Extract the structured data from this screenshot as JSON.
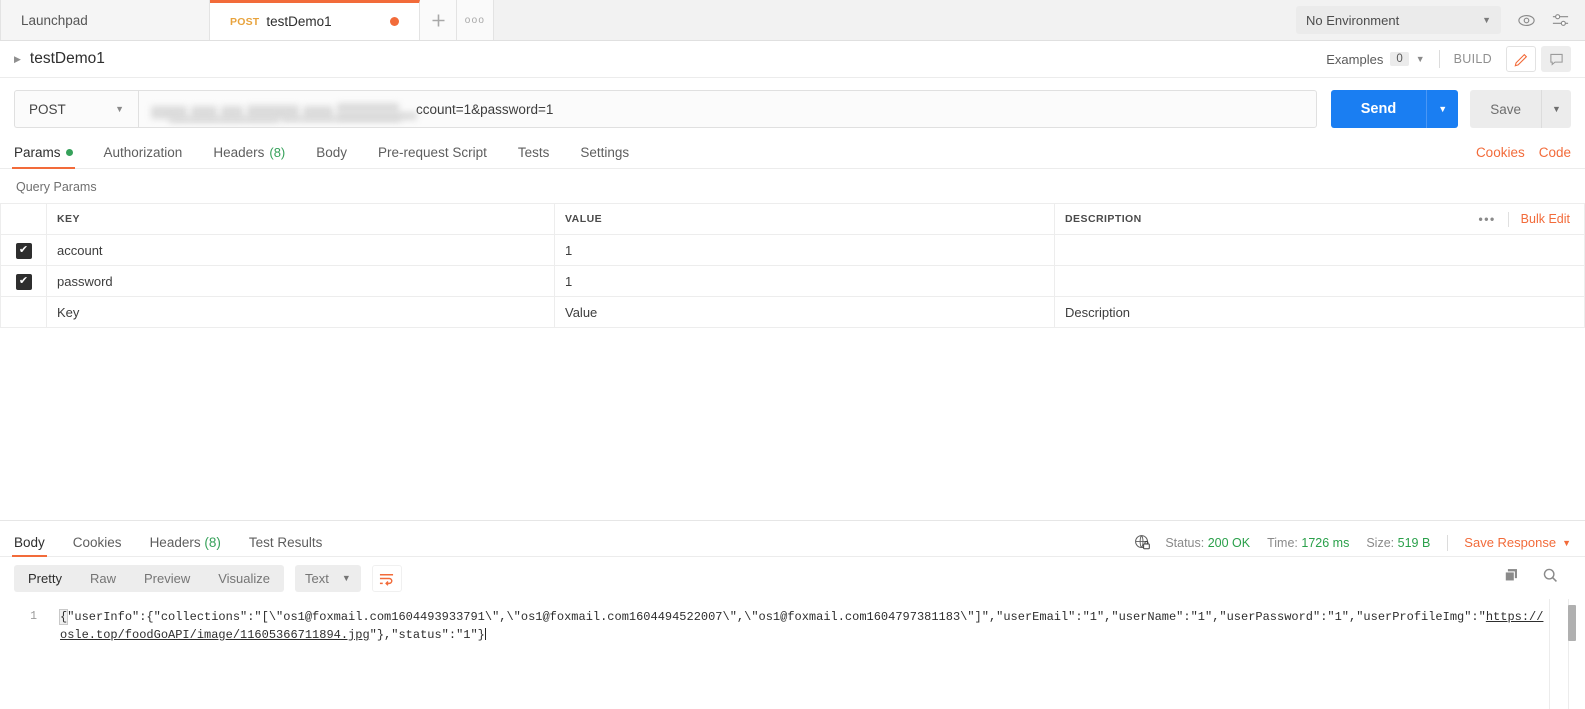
{
  "tabbar": {
    "tabs": [
      {
        "label": "Launchpad",
        "method": "",
        "dirty": false,
        "active": false
      },
      {
        "label": "testDemo1",
        "method": "POST",
        "dirty": true,
        "active": true
      }
    ],
    "new_tab_label": "+",
    "more_tabs_label": "ooo",
    "environment": "No Environment",
    "eye_icon": "eye-icon",
    "settings_icon": "sliders-icon"
  },
  "breadcrumb": {
    "title": "testDemo1",
    "examples_label": "Examples",
    "examples_count": "0",
    "build_label": "BUILD",
    "edit_icon": "pencil-icon",
    "comment_icon": "comment-icon"
  },
  "request": {
    "method": "POST",
    "url_tail": "ccount=1&password=1",
    "send_label": "Send",
    "save_label": "Save",
    "tabs": [
      {
        "label": "Params",
        "badge": "",
        "dot": true,
        "active": true
      },
      {
        "label": "Authorization",
        "badge": "",
        "dot": false,
        "active": false
      },
      {
        "label": "Headers",
        "badge": "(8)",
        "dot": false,
        "active": false
      },
      {
        "label": "Body",
        "badge": "",
        "dot": false,
        "active": false
      },
      {
        "label": "Pre-request Script",
        "badge": "",
        "dot": false,
        "active": false
      },
      {
        "label": "Tests",
        "badge": "",
        "dot": false,
        "active": false
      },
      {
        "label": "Settings",
        "badge": "",
        "dot": false,
        "active": false
      }
    ],
    "cookies_link": "Cookies",
    "code_link": "Code"
  },
  "params": {
    "section_label": "Query Params",
    "columns": [
      "KEY",
      "VALUE",
      "DESCRIPTION"
    ],
    "bulk_edit_label": "Bulk Edit",
    "more_label": "•••",
    "rows": [
      {
        "checked": true,
        "key": "account",
        "value": "1",
        "description": ""
      },
      {
        "checked": true,
        "key": "password",
        "value": "1",
        "description": ""
      }
    ],
    "placeholder_row": {
      "key": "Key",
      "value": "Value",
      "description": "Description"
    }
  },
  "response": {
    "tabs": [
      {
        "label": "Body",
        "badge": "",
        "active": true
      },
      {
        "label": "Cookies",
        "badge": "",
        "active": false
      },
      {
        "label": "Headers",
        "badge": "(8)",
        "active": false
      },
      {
        "label": "Test Results",
        "badge": "",
        "active": false
      }
    ],
    "lock_icon": "globe-lock-icon",
    "status_label": "Status:",
    "status_value": "200 OK",
    "time_label": "Time:",
    "time_value": "1726 ms",
    "size_label": "Size:",
    "size_value": "519 B",
    "save_response_label": "Save Response",
    "format_tabs": [
      "Pretty",
      "Raw",
      "Preview",
      "Visualize"
    ],
    "active_format": "Pretty",
    "type_value": "Text",
    "wrap_icon": "wrap-lines-icon",
    "copy_icon": "copy-icon",
    "search_icon": "search-icon",
    "line_number": "1",
    "body_part1": "{\"userInfo\":{\"collections\":\"[\\\"os1@foxmail.com1604493933791\\\",\\\"os1@foxmail.com1604494522007\\\",\\\"os1@foxmail.com1604797381183\\\"]\",\"userEmail\":\"1\",\"userName\":\"1\",\"userPassword\":\"1\",\"userProfileImg\":\"",
    "body_link": "https://osle.top/foodGoAPI/image/11605366711894.jpg",
    "body_part2": "\"},\"status\":\"1\"}"
  },
  "colors": {
    "accent_orange": "#f26b3a",
    "send_blue": "#1a7ef2",
    "success_green": "#2aa04a",
    "method_post": "#e8a33d"
  }
}
